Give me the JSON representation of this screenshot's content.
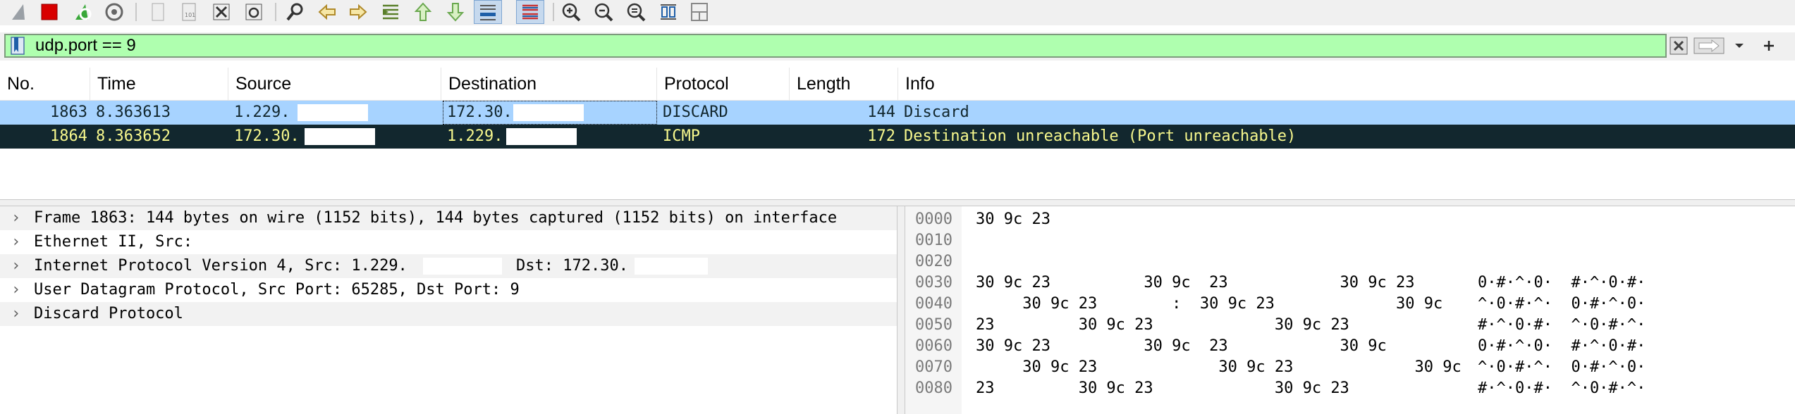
{
  "toolbar": {
    "buttons": [
      {
        "name": "start-capture-icon",
        "color": "#9aa0a6"
      },
      {
        "name": "stop-capture-icon",
        "color": "#d80000"
      },
      {
        "name": "restart-capture-icon",
        "color": "#3aa83a"
      },
      {
        "name": "capture-options-icon",
        "color": "#666666"
      },
      {
        "name": "open-file-icon",
        "color": "#9a9a9a"
      },
      {
        "name": "save-file-icon",
        "color": "#9a9a9a"
      },
      {
        "name": "close-file-icon",
        "color": "#555555"
      },
      {
        "name": "reload-file-icon",
        "color": "#555555"
      },
      {
        "name": "find-packet-icon",
        "color": "#333333"
      },
      {
        "name": "go-back-icon",
        "color": "#b08a2a"
      },
      {
        "name": "go-forward-icon",
        "color": "#b08a2a"
      },
      {
        "name": "go-to-packet-icon",
        "color": "#5a7f2a"
      },
      {
        "name": "go-first-packet-icon",
        "color": "#6aa84f"
      },
      {
        "name": "go-last-packet-icon",
        "color": "#6aa84f"
      },
      {
        "name": "auto-scroll-icon",
        "color": "#1f5fa8"
      },
      {
        "name": "colorize-icon",
        "color": "#c83232"
      },
      {
        "name": "zoom-in-icon",
        "color": "#333333"
      },
      {
        "name": "zoom-out-icon",
        "color": "#333333"
      },
      {
        "name": "normal-size-icon",
        "color": "#333333"
      },
      {
        "name": "resize-columns-icon",
        "color": "#1f5fa8"
      },
      {
        "name": "layout-icon",
        "color": "#888888"
      }
    ]
  },
  "filter": {
    "value": "udp.port == 9",
    "bg_color": "#afffaf"
  },
  "packet_list": {
    "columns": [
      "No.",
      "Time",
      "Source",
      "Destination",
      "Protocol",
      "Length",
      "Info"
    ],
    "rows": [
      {
        "no": "1863",
        "time": "8.363613",
        "source": "1.229.",
        "destination": "172.30.",
        "protocol": "DISCARD",
        "length": "144",
        "info": "Discard"
      },
      {
        "no": "1864",
        "time": "8.363652",
        "source": "172.30.",
        "destination": "1.229.",
        "protocol": "ICMP",
        "length": "172",
        "info": "Destination unreachable (Port unreachable)"
      }
    ],
    "row_colors": {
      "discard_bg": "#a7d3ff",
      "icmp_bg": "#12272e",
      "icmp_fg": "#f7f88d"
    }
  },
  "details": {
    "lines": [
      "Frame 1863: 144 bytes on wire (1152 bits), 144 bytes captured (1152 bits) on interface",
      "Ethernet II, Src:",
      "Internet Protocol Version 4, Src: 1.229.",
      "User Datagram Protocol, Src Port: 65285, Dst Port: 9",
      "Discard Protocol"
    ],
    "ip_dst_label": "Dst: 172.30."
  },
  "bytes": {
    "rows": [
      {
        "offset": "0000",
        "hex": "30 9c 23",
        "ascii": ""
      },
      {
        "offset": "0010",
        "hex": "",
        "ascii": ""
      },
      {
        "offset": "0020",
        "hex": "",
        "ascii": ""
      },
      {
        "offset": "0030",
        "hex": "30 9c 23          30 9c  23            30 9c 23",
        "ascii": "0·#·^·0·  #·^·0·#·"
      },
      {
        "offset": "0040",
        "hex": "     30 9c 23        :  30 9c 23             30 9c",
        "ascii": "^·0·#·^·  0·#·^·0·"
      },
      {
        "offset": "0050",
        "hex": "23         30 9c 23             30 9c 23",
        "ascii": "#·^·0·#·  ^·0·#·^·"
      },
      {
        "offset": "0060",
        "hex": "30 9c 23          30 9c  23            30 9c",
        "ascii": "0·#·^·0·  #·^·0·#·"
      },
      {
        "offset": "0070",
        "hex": "     30 9c 23             30 9c 23             30 9c",
        "ascii": "^·0·#·^·  0·#·^·0·"
      },
      {
        "offset": "0080",
        "hex": "23         30 9c 23             30 9c 23",
        "ascii": "#·^·0·#·  ^·0·#·^·"
      }
    ]
  }
}
